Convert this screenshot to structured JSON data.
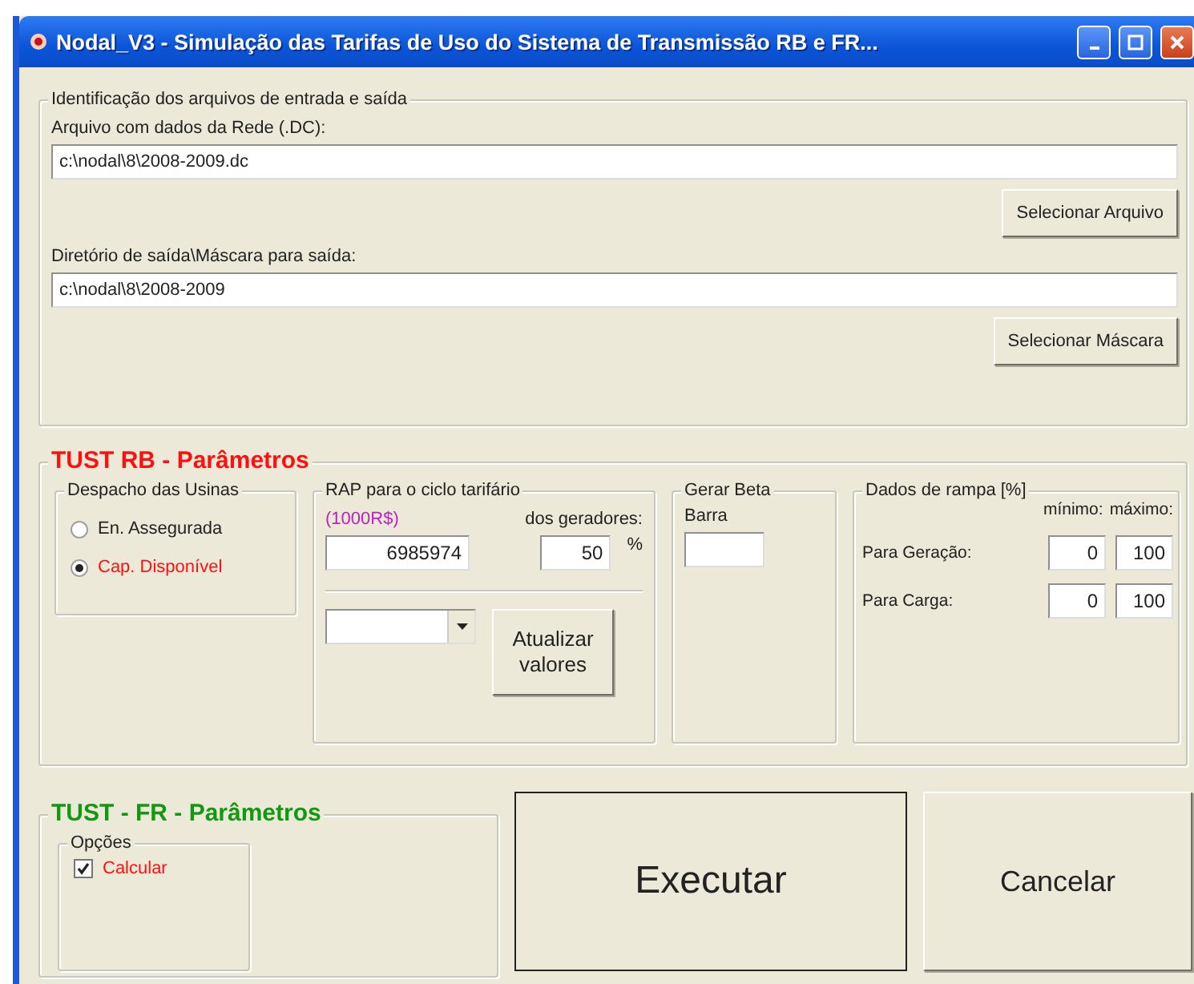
{
  "window": {
    "title": "Nodal_V3 - Simulação das Tarifas de Uso do Sistema de Transmissão RB e FR..."
  },
  "files": {
    "legend": "Identificação dos arquivos de entrada e saída",
    "input_file": {
      "label": "Arquivo com dados da Rede (.DC):",
      "value": "c:\\nodal\\8\\2008-2009.dc",
      "button": "Selecionar Arquivo"
    },
    "output": {
      "label": "Diretório de saída\\Máscara para saída:",
      "value": "c:\\nodal\\8\\2008-2009",
      "button": "Selecionar Máscara"
    }
  },
  "tust_rb": {
    "title": "TUST RB - Parâmetros",
    "color": "#ff1010",
    "dispatch": {
      "legend": "Despacho das Usinas",
      "options": [
        {
          "label": "En. Assegurada",
          "selected": false
        },
        {
          "label": "Cap. Disponível",
          "selected": true
        }
      ]
    },
    "rap": {
      "legend": "RAP para o ciclo tarifário",
      "unit": "(1000R$)",
      "generators_label": "dos geradores:",
      "value": "6985974",
      "generators_value": "50",
      "percent": "%",
      "button": "Atualizar valores"
    },
    "beta": {
      "legend": "Gerar Beta",
      "label": "Barra"
    },
    "ramp": {
      "legend": "Dados de rampa [%]",
      "min_label": "mínimo:",
      "max_label": "máximo:",
      "rows": [
        {
          "label": "Para Geração:",
          "min": "0",
          "max": "100"
        },
        {
          "label": "Para Carga:",
          "min": "0",
          "max": "100"
        }
      ]
    }
  },
  "tust_fr": {
    "title": "TUST - FR - Parâmetros",
    "color": "#119911",
    "options": {
      "legend": "Opções",
      "items": [
        {
          "label": "Calcular",
          "checked": true
        }
      ]
    }
  },
  "buttons": [
    {
      "label": "Executar",
      "kind": "primary"
    },
    {
      "label": "Cancelar",
      "kind": "normal"
    }
  ]
}
